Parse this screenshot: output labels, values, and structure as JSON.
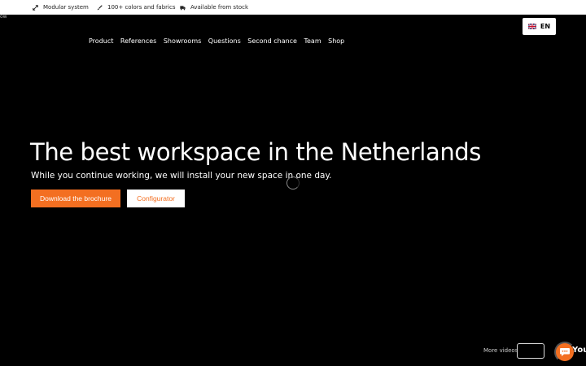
{
  "usp": {
    "items": [
      {
        "icon": "expand-arrows-icon",
        "label": "Modular system"
      },
      {
        "icon": "brush-icon",
        "label": "100+ colors and fabrics"
      },
      {
        "icon": "truck-icon",
        "label": "Available from stock"
      }
    ]
  },
  "stray_text": "ow",
  "language": {
    "code": "EN",
    "flag": "uk-flag-icon"
  },
  "nav": {
    "items": [
      "Product",
      "References",
      "Showrooms",
      "Questions",
      "Second chance",
      "Team",
      "Shop"
    ]
  },
  "hero": {
    "title": "The best workspace in the Netherlands",
    "subtitle": "While you continue working, we will install your new space in one day.",
    "primary_cta": "Download the brochure",
    "secondary_cta": "Configurator"
  },
  "footer": {
    "more_videos": "More videos",
    "youtube_label": "YouT"
  },
  "colors": {
    "accent": "#f36f21",
    "background": "#000000",
    "bar": "#ffffff"
  }
}
